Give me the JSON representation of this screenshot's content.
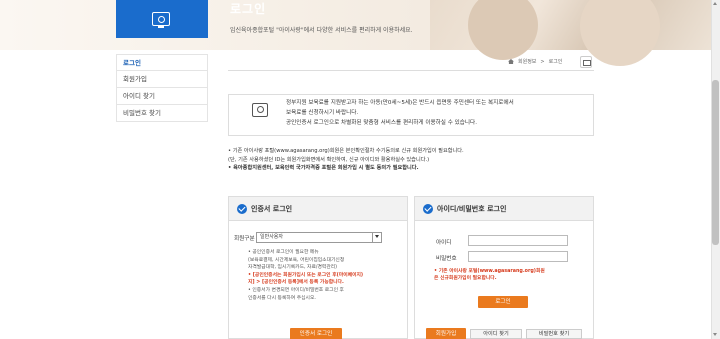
{
  "header": {
    "title": "로그인",
    "description": "임신육아종합포털 \"아이사랑\"에서 다양한 서비스를 편리하게 이용하세요."
  },
  "sidebar": {
    "items": [
      {
        "label": "로그인"
      },
      {
        "label": "회원가입"
      },
      {
        "label": "아이디 찾기"
      },
      {
        "label": "비밀번호 찾기"
      }
    ]
  },
  "breadcrumb": {
    "items": [
      "회원정보",
      "로그인"
    ]
  },
  "info_box": {
    "line1": "정부지원 보육료를 지원받고자 하는 아동(만0세~5세)은 반드시 읍면동 주민센터 또는 복지로에서",
    "line2": "보육료를 신청하시기 바랍니다.",
    "line3": "공인인증서 로그인으로 차별화된 맞춤형 서비스를 편리하게 이용하실 수 있습니다."
  },
  "notes": {
    "n1": "• 기존 아이사랑 포털(www.agasarang.org)회원은 본인확인절차 수기등의로 신규 회원가입이 필요합니다.",
    "n2": "(단, 기존 사용하셨던 ID는 회원가입화면에서 확인하여, 신규 아이디와 활용하실수 있습니다.)",
    "n3": "• 육아종합지원센터, 보육인력 국가자격증 포털은 회원가입 시 별도 동의가 필요합니다."
  },
  "cert_panel": {
    "title": "인증서 로그인",
    "member_type_label": "회원구분",
    "member_type_value": "일반사용자",
    "note1": "• 공인인증서 로그인이 필요한 메뉴",
    "note2": "(보육료결제, 시간제보육, 어린이집입소대기신청",
    "note3": "자격발급대학, 임시기록카드, 자료/경력관리)",
    "note4": "• [공인인증서는 회원가입시 또는 로그인 후(마이페이지)",
    "note5": "지] > [공인인증서 등록]에서 등록 가능합니다.",
    "note6": "• 인증서가 변경되면 아이디/비밀번호 로그인 후",
    "note7": "인증서를 다시 등록하여 주십시오.",
    "button": "인증서 로그인"
  },
  "id_panel": {
    "title": "아이디/비밀번호 로그인",
    "id_label": "아이디",
    "pw_label": "비밀번호",
    "note1": "• 기존 아이사랑 포털(www.agasarang.org)회원",
    "note2": "은 신규회원가입이 필요합니다.",
    "login_button": "로그인",
    "join_button": "회원가입",
    "find_id_button": "아이디 찾기",
    "find_pw_button": "비밀번호 찾기"
  },
  "colors": {
    "brand_blue": "#1a6ccc",
    "accent_orange": "#ea7a1e",
    "note_red": "#d63a1c"
  }
}
